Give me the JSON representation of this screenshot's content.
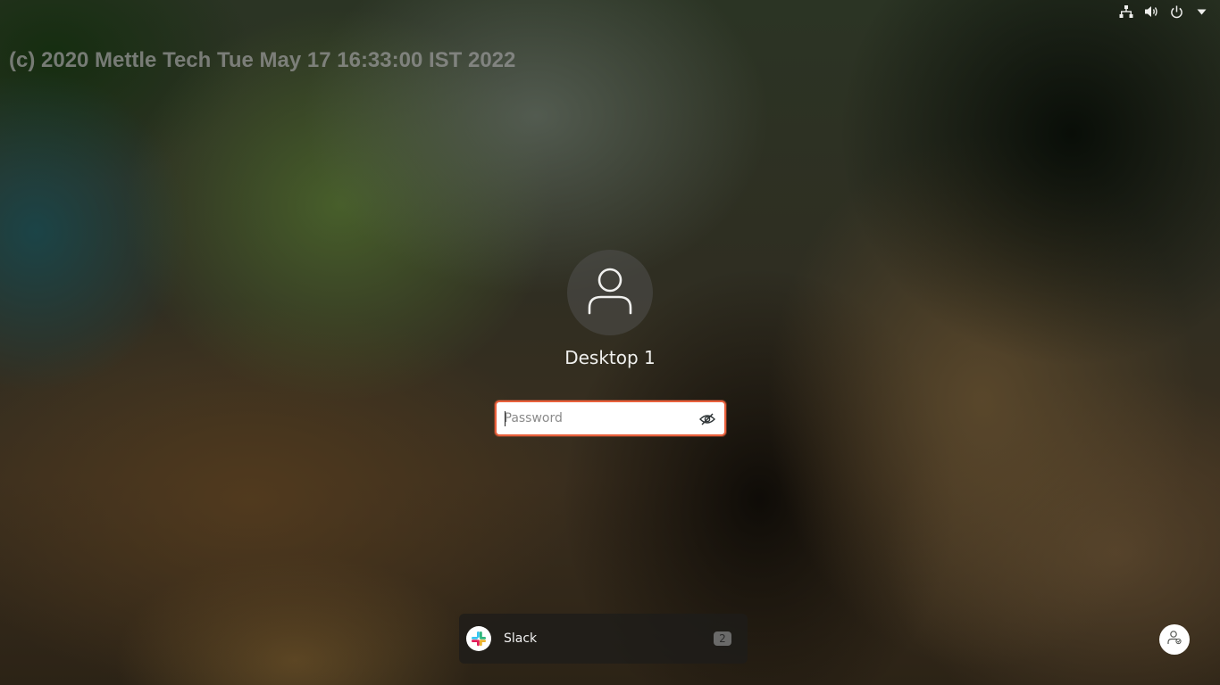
{
  "watermark": {
    "text": "(c) 2020 Mettle Tech Tue May 17 16:33:00 IST 2022"
  },
  "status_bar": {
    "icons": [
      "network-icon",
      "volume-icon",
      "power-icon",
      "chevron-down-icon"
    ]
  },
  "login": {
    "avatar_icon": "user-icon",
    "username": "Desktop 1",
    "password": {
      "value": "",
      "placeholder": "Password",
      "reveal_icon": "eye-hidden-icon"
    }
  },
  "notification": {
    "app_name": "Slack",
    "app_icon": "slack-icon",
    "count": "2"
  },
  "accessibility_button": {
    "icon": "accessibility-icon"
  },
  "colors": {
    "focus_border": "#e9603c",
    "watermark_text": "#969696"
  }
}
